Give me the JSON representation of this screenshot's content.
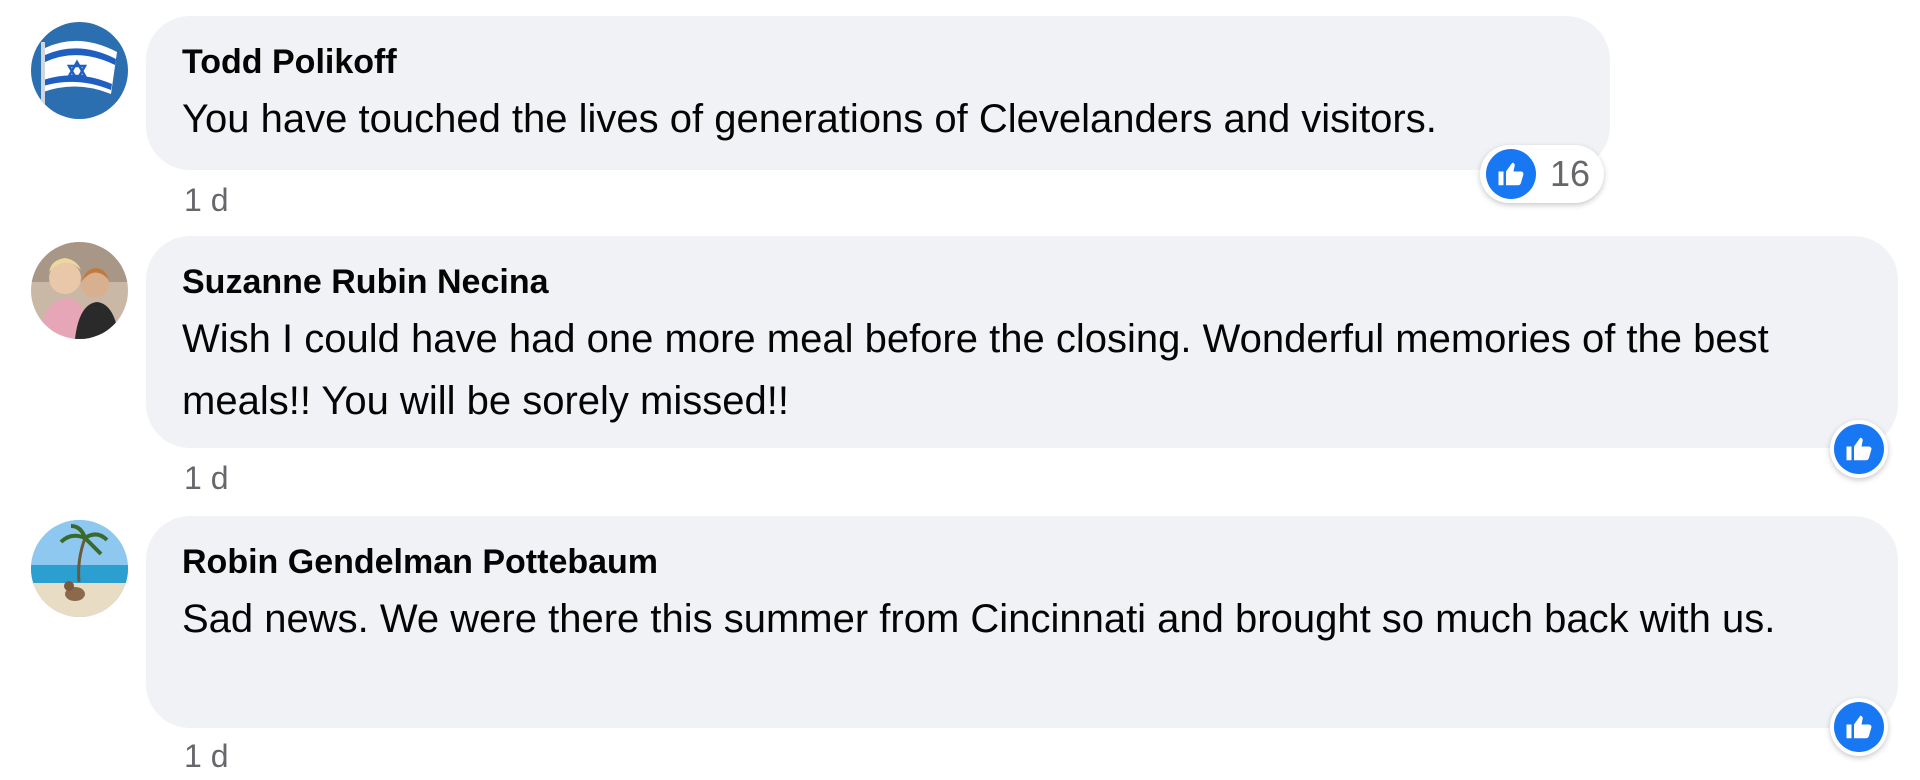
{
  "comments": [
    {
      "author": "Todd Polikoff",
      "text": "You have touched the lives of generations of Clevelanders and visitors.",
      "time": "1 d",
      "reaction_icon": "like-icon",
      "reaction_count": "16"
    },
    {
      "author": "Suzanne Rubin Necina",
      "text": "Wish I could have had one more meal before the closing. Wonderful memories of the best meals!! You will be sorely missed!!",
      "time": "1 d",
      "reaction_icon": "like-icon"
    },
    {
      "author": "Robin Gendelman Pottebaum",
      "text": "Sad news. We were there this summer from Cincinnati and brought so much back with us.",
      "time": "1 d",
      "reaction_icon": "like-icon"
    }
  ],
  "colors": {
    "bubble": "#f0f2f5",
    "like": "#1877f2",
    "secondary_text": "#65676b"
  }
}
